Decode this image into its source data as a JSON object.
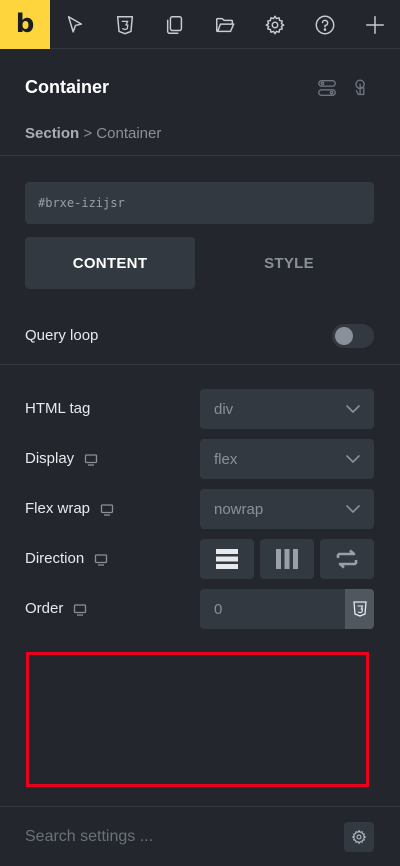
{
  "app": {
    "logo_letter": "b",
    "accent_color": "#ffd53e"
  },
  "toolbar": {
    "icons": [
      "pointer-icon",
      "css3-icon",
      "pages-icon",
      "folder-icon",
      "settings-gear-icon",
      "help-icon",
      "add-icon"
    ]
  },
  "panel": {
    "title": "Container",
    "breadcrumb": {
      "parent": "Section",
      "separator": ">",
      "current": "Container"
    }
  },
  "element_id": "#brxe-izijsr",
  "tabs": {
    "content": "CONTENT",
    "style": "STYLE",
    "active": "CONTENT"
  },
  "query_loop": {
    "label": "Query loop",
    "enabled": false
  },
  "settings": {
    "html_tag": {
      "label": "HTML tag",
      "value": "div"
    },
    "display": {
      "label": "Display",
      "value": "flex"
    },
    "flex_wrap": {
      "label": "Flex wrap",
      "value": "nowrap"
    },
    "direction": {
      "label": "Direction",
      "options": [
        "row",
        "column",
        "reverse"
      ]
    },
    "order": {
      "label": "Order",
      "placeholder": "0"
    }
  },
  "footer": {
    "search_placeholder": "Search settings ..."
  }
}
